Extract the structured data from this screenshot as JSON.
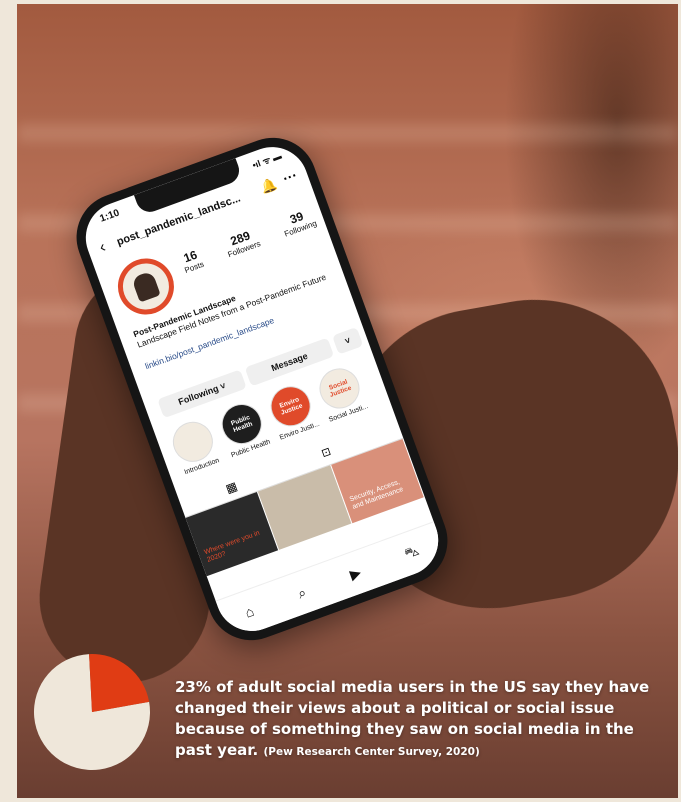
{
  "status": {
    "time": "1:10",
    "signal": "•ıl ᯤ ▬"
  },
  "profile": {
    "username": "post_pandemic_landsc...",
    "name": "Post-Pandemic Landscape",
    "bio": "Landscape Field Notes from a Post-Pandemic Future",
    "link": "linkin.bio/post_pandemic_landscape",
    "stats": [
      {
        "num": "16",
        "label": "Posts"
      },
      {
        "num": "289",
        "label": "Followers"
      },
      {
        "num": "39",
        "label": "Following"
      }
    ],
    "buttons": {
      "following": "Following ˅",
      "message": "Message",
      "more": "˅"
    }
  },
  "highlights": [
    {
      "label": "Introduction",
      "inner": "",
      "color": "#f2ebe0"
    },
    {
      "label": "Public Health",
      "inner": "Public Health",
      "color": "#1e1e1e"
    },
    {
      "label": "Enviro Justi...",
      "inner": "Enviro Justice",
      "color": "#e04a2a"
    },
    {
      "label": "Social Justi...",
      "inner": "Social Justice",
      "color": "#f2ebe0"
    }
  ],
  "posts": [
    {
      "text": "Where were you in 2020?"
    },
    {
      "text": ""
    },
    {
      "text": "Security, Access, and Maintenance"
    }
  ],
  "icons": {
    "back": "‹",
    "bell": "🔔",
    "more": "···",
    "grid": "▦",
    "tagged": "⊡",
    "home": "⌂",
    "search": "⌕",
    "reels": "▶",
    "shop": "⛍"
  },
  "caption": {
    "main": "23% of adult social media users in the US say they have changed their views about a political or social issue because of something they saw on social media in the past year.",
    "source": "(Pew Research Center Survey, 2020)"
  },
  "chart_data": {
    "type": "pie",
    "values": [
      23,
      77
    ],
    "colors": [
      "#e03c14",
      "#efe7da"
    ]
  }
}
